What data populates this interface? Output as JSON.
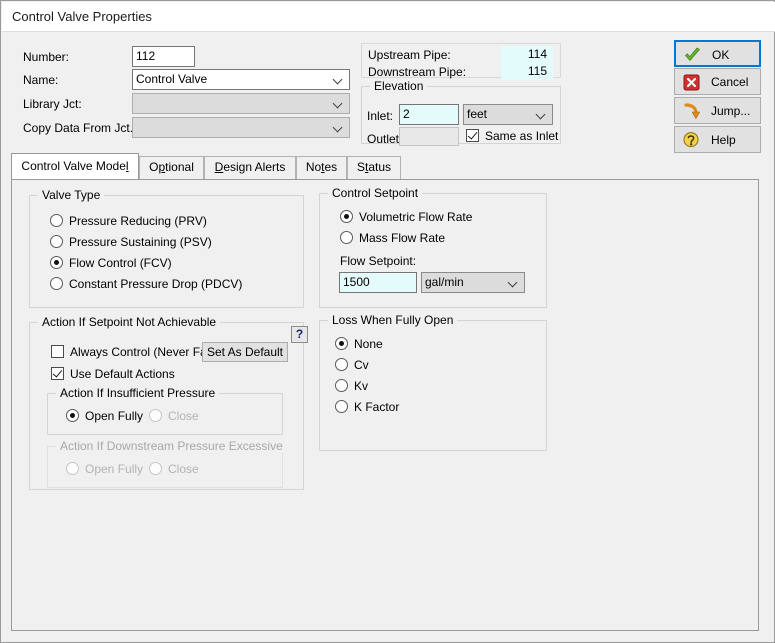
{
  "window": {
    "title": "Control Valve Properties"
  },
  "form": {
    "number_label": "Number:",
    "number_value": "112",
    "name_label": "Name:",
    "name_value": "Control Valve",
    "library_label": "Library Jct:",
    "library_value": "",
    "copy_label": "Copy Data From Jct...",
    "copy_value": ""
  },
  "pipes": {
    "upstream_label": "Upstream Pipe:",
    "upstream_value": "114",
    "downstream_label": "Downstream Pipe:",
    "downstream_value": "115"
  },
  "elevation": {
    "group_title": "Elevation",
    "inlet_label": "Inlet:",
    "inlet_value": "2",
    "units_value": "feet",
    "outlet_label": "Outlet:",
    "outlet_value": "",
    "same_as_inlet_label": "Same as Inlet",
    "same_as_inlet_checked": true
  },
  "buttons": {
    "ok": "OK",
    "cancel": "Cancel",
    "jump": "Jump...",
    "help": "Help"
  },
  "tabs": [
    {
      "label": "Control Valve Model",
      "accesskey": "l",
      "active": true
    },
    {
      "label": "Optional",
      "accesskey": "p",
      "active": false
    },
    {
      "label": "Design Alerts",
      "accesskey": "D",
      "active": false
    },
    {
      "label": "Notes",
      "accesskey": "t",
      "active": false
    },
    {
      "label": "Status",
      "accesskey": "t",
      "active": false
    }
  ],
  "valve_type": {
    "group_title": "Valve Type",
    "options": [
      {
        "label": "Pressure Reducing (PRV)",
        "selected": false
      },
      {
        "label": "Pressure Sustaining (PSV)",
        "selected": false
      },
      {
        "label": "Flow Control (FCV)",
        "selected": true
      },
      {
        "label": "Constant Pressure Drop (PDCV)",
        "selected": false
      }
    ]
  },
  "control_setpoint": {
    "group_title": "Control Setpoint",
    "options": [
      {
        "label": "Volumetric Flow Rate",
        "selected": true
      },
      {
        "label": "Mass Flow Rate",
        "selected": false
      }
    ],
    "setpoint_label": "Flow Setpoint:",
    "setpoint_value": "1500",
    "setpoint_units": "gal/min"
  },
  "action_group": {
    "group_title": "Action If Setpoint Not Achievable",
    "always_control_label": "Always Control (Never Fail)",
    "always_control_checked": false,
    "set_as_default_label": "Set As Default",
    "help_mark": "?",
    "use_default_actions_label": "Use Default Actions",
    "use_default_actions_checked": true,
    "insufficient": {
      "group_title": "Action If Insufficient Pressure",
      "options": [
        {
          "label": "Open Fully",
          "selected": true,
          "disabled": false
        },
        {
          "label": "Close",
          "selected": false,
          "disabled": true
        }
      ]
    },
    "excessive": {
      "group_title": "Action If Downstream Pressure Excessive",
      "disabled": true,
      "options": [
        {
          "label": "Open Fully",
          "selected": false,
          "disabled": true
        },
        {
          "label": "Close",
          "selected": false,
          "disabled": true
        }
      ]
    }
  },
  "loss": {
    "group_title": "Loss When Fully Open",
    "options": [
      {
        "label": "None",
        "selected": true
      },
      {
        "label": "Cv",
        "selected": false
      },
      {
        "label": "Kv",
        "selected": false
      },
      {
        "label": "K Factor",
        "selected": false
      }
    ]
  },
  "colors": {
    "accent": "#0078d7",
    "field_highlight": "#e4fbfb",
    "window_bg": "#f0f0f0"
  }
}
